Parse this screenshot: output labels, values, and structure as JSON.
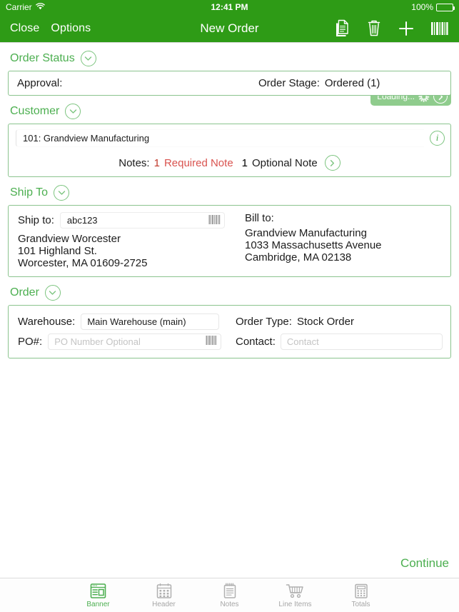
{
  "status_bar": {
    "carrier": "Carrier",
    "wifi_icon": "wifi-icon",
    "time": "12:41 PM",
    "battery_percent": "100%",
    "battery_icon": "battery-full-icon"
  },
  "nav_bar": {
    "close_label": "Close",
    "options_label": "Options",
    "title": "New Order",
    "icons": [
      {
        "name": "copy-document-icon"
      },
      {
        "name": "trash-icon"
      },
      {
        "name": "plus-icon"
      },
      {
        "name": "barcode-icon"
      }
    ]
  },
  "loading_badge": {
    "label": "Loading...",
    "spinner_icon": "spinner-icon",
    "arrow_icon": "chevron-right-circle-icon"
  },
  "sections": {
    "order_status": {
      "title": "Order Status",
      "collapse_icon": "chevron-down-circle-icon",
      "approval_label": "Approval:",
      "approval_value": "",
      "order_stage_label": "Order Stage:",
      "order_stage_value": "Ordered (1)"
    },
    "customer": {
      "title": "Customer",
      "collapse_icon": "chevron-down-circle-icon",
      "customer_value": "101: Grandview Manufacturing",
      "info_icon": "info-circle-icon",
      "notes_label": "Notes:",
      "required_count": "1",
      "required_label": "Required Note",
      "optional_count": "1",
      "optional_label": "Optional Note",
      "notes_arrow_icon": "chevron-right-circle-icon"
    },
    "ship_to": {
      "title": "Ship To",
      "collapse_icon": "chevron-down-circle-icon",
      "ship_to_label": "Ship to:",
      "ship_to_value": "abc123",
      "ship_barcode_icon": "barcode-icon",
      "ship_address": [
        "Grandview Worcester",
        "101 Highland St.",
        "Worcester, MA 01609-2725"
      ],
      "bill_to_label": "Bill to:",
      "bill_address": [
        "Grandview Manufacturing",
        "1033 Massachusetts Avenue",
        "Cambridge, MA 02138"
      ]
    },
    "order": {
      "title": "Order",
      "collapse_icon": "chevron-down-circle-icon",
      "warehouse_label": "Warehouse:",
      "warehouse_value": "Main Warehouse (main)",
      "order_type_label": "Order Type:",
      "order_type_value": "Stock Order",
      "po_label": "PO#:",
      "po_placeholder": "PO Number Optional",
      "po_barcode_icon": "barcode-icon",
      "contact_label": "Contact:",
      "contact_placeholder": "Contact"
    }
  },
  "footer": {
    "continue_label": "Continue"
  },
  "tab_bar": {
    "tabs": [
      {
        "label": "Banner",
        "icon": "banner-icon",
        "active": true
      },
      {
        "label": "Header",
        "icon": "grid-icon",
        "active": false
      },
      {
        "label": "Notes",
        "icon": "notepad-icon",
        "active": false
      },
      {
        "label": "Line Items",
        "icon": "cart-icon",
        "active": false
      },
      {
        "label": "Totals",
        "icon": "calculator-icon",
        "active": false
      }
    ]
  },
  "colors": {
    "brand_green": "#2e9b16",
    "accent_green": "#4caf50",
    "border_green": "#8bc48e",
    "required_red": "#d9534f",
    "badge_green": "#8fcc8d"
  }
}
